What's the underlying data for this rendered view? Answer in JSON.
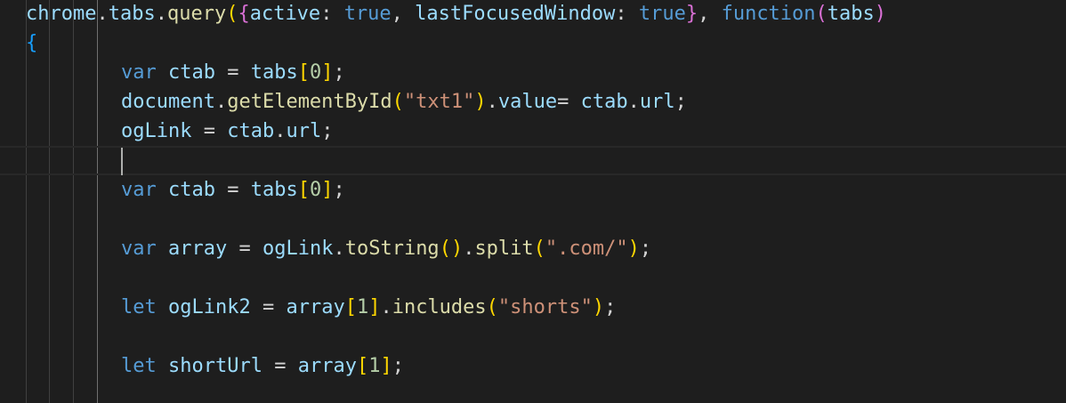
{
  "editor": {
    "colors": {
      "background": "#1e1e1e",
      "default_text": "#d4d4d4",
      "function": "#dcdcaa",
      "variable": "#9cdcfe",
      "keyword": "#569cd6",
      "string": "#ce9178",
      "number": "#b5cea8",
      "bracket_1": "#ffd700",
      "bracket_2": "#da70d6",
      "bracket_3": "#179fff"
    },
    "lines": [
      {
        "tokens": [
          {
            "t": "chrome",
            "c": "var"
          },
          {
            "t": ".",
            "c": "punc"
          },
          {
            "t": "tabs",
            "c": "var"
          },
          {
            "t": ".",
            "c": "punc"
          },
          {
            "t": "query",
            "c": "fn"
          },
          {
            "t": "(",
            "c": "br1"
          },
          {
            "t": "{",
            "c": "br2"
          },
          {
            "t": "active",
            "c": "var"
          },
          {
            "t": ": ",
            "c": "punc"
          },
          {
            "t": "true",
            "c": "kw"
          },
          {
            "t": ", ",
            "c": "punc"
          },
          {
            "t": "lastFocusedWindow",
            "c": "var"
          },
          {
            "t": ": ",
            "c": "punc"
          },
          {
            "t": "true",
            "c": "kw"
          },
          {
            "t": "}",
            "c": "br2"
          },
          {
            "t": ", ",
            "c": "punc"
          },
          {
            "t": "function",
            "c": "kw"
          },
          {
            "t": "(",
            "c": "br2"
          },
          {
            "t": "tabs",
            "c": "var"
          },
          {
            "t": ")",
            "c": "br2"
          }
        ]
      },
      {
        "tokens": [
          {
            "t": "{",
            "c": "br3"
          }
        ]
      },
      {
        "tokens": [
          {
            "t": "var",
            "c": "kw"
          },
          {
            "t": " ",
            "c": "punc"
          },
          {
            "t": "ctab",
            "c": "var"
          },
          {
            "t": " = ",
            "c": "punc"
          },
          {
            "t": "tabs",
            "c": "var"
          },
          {
            "t": "[",
            "c": "br1"
          },
          {
            "t": "0",
            "c": "num"
          },
          {
            "t": "]",
            "c": "br1"
          },
          {
            "t": ";",
            "c": "punc"
          }
        ]
      },
      {
        "tokens": [
          {
            "t": "document",
            "c": "var"
          },
          {
            "t": ".",
            "c": "punc"
          },
          {
            "t": "getElementById",
            "c": "fn"
          },
          {
            "t": "(",
            "c": "br1"
          },
          {
            "t": "\"txt1\"",
            "c": "str"
          },
          {
            "t": ")",
            "c": "br1"
          },
          {
            "t": ".",
            "c": "punc"
          },
          {
            "t": "value",
            "c": "var"
          },
          {
            "t": "= ",
            "c": "punc"
          },
          {
            "t": "ctab",
            "c": "var"
          },
          {
            "t": ".",
            "c": "punc"
          },
          {
            "t": "url",
            "c": "var"
          },
          {
            "t": ";",
            "c": "punc"
          }
        ]
      },
      {
        "tokens": [
          {
            "t": "ogLink",
            "c": "var"
          },
          {
            "t": " = ",
            "c": "punc"
          },
          {
            "t": "ctab",
            "c": "var"
          },
          {
            "t": ".",
            "c": "punc"
          },
          {
            "t": "url",
            "c": "var"
          },
          {
            "t": ";",
            "c": "punc"
          }
        ]
      },
      {
        "tokens": []
      },
      {
        "tokens": [
          {
            "t": "var",
            "c": "kw"
          },
          {
            "t": " ",
            "c": "punc"
          },
          {
            "t": "ctab",
            "c": "var"
          },
          {
            "t": " = ",
            "c": "punc"
          },
          {
            "t": "tabs",
            "c": "var"
          },
          {
            "t": "[",
            "c": "br1"
          },
          {
            "t": "0",
            "c": "num"
          },
          {
            "t": "]",
            "c": "br1"
          },
          {
            "t": ";",
            "c": "punc"
          }
        ]
      },
      {
        "tokens": []
      },
      {
        "tokens": [
          {
            "t": "var",
            "c": "kw"
          },
          {
            "t": " ",
            "c": "punc"
          },
          {
            "t": "array",
            "c": "var"
          },
          {
            "t": " = ",
            "c": "punc"
          },
          {
            "t": "ogLink",
            "c": "var"
          },
          {
            "t": ".",
            "c": "punc"
          },
          {
            "t": "toString",
            "c": "fn"
          },
          {
            "t": "(",
            "c": "br1"
          },
          {
            "t": ")",
            "c": "br1"
          },
          {
            "t": ".",
            "c": "punc"
          },
          {
            "t": "split",
            "c": "fn"
          },
          {
            "t": "(",
            "c": "br1"
          },
          {
            "t": "\".com/\"",
            "c": "str"
          },
          {
            "t": ")",
            "c": "br1"
          },
          {
            "t": ";",
            "c": "punc"
          }
        ]
      },
      {
        "tokens": []
      },
      {
        "tokens": [
          {
            "t": "let",
            "c": "kw"
          },
          {
            "t": " ",
            "c": "punc"
          },
          {
            "t": "ogLink2",
            "c": "var"
          },
          {
            "t": " = ",
            "c": "punc"
          },
          {
            "t": "array",
            "c": "var"
          },
          {
            "t": "[",
            "c": "br1"
          },
          {
            "t": "1",
            "c": "num"
          },
          {
            "t": "]",
            "c": "br1"
          },
          {
            "t": ".",
            "c": "punc"
          },
          {
            "t": "includes",
            "c": "fn"
          },
          {
            "t": "(",
            "c": "br1"
          },
          {
            "t": "\"shorts\"",
            "c": "str"
          },
          {
            "t": ")",
            "c": "br1"
          },
          {
            "t": ";",
            "c": "punc"
          }
        ]
      },
      {
        "tokens": []
      },
      {
        "tokens": [
          {
            "t": "let",
            "c": "kw"
          },
          {
            "t": " ",
            "c": "punc"
          },
          {
            "t": "shortUrl",
            "c": "var"
          },
          {
            "t": " = ",
            "c": "punc"
          },
          {
            "t": "array",
            "c": "var"
          },
          {
            "t": "[",
            "c": "br1"
          },
          {
            "t": "1",
            "c": "num"
          },
          {
            "t": "]",
            "c": "br1"
          },
          {
            "t": ";",
            "c": "punc"
          }
        ]
      }
    ]
  }
}
